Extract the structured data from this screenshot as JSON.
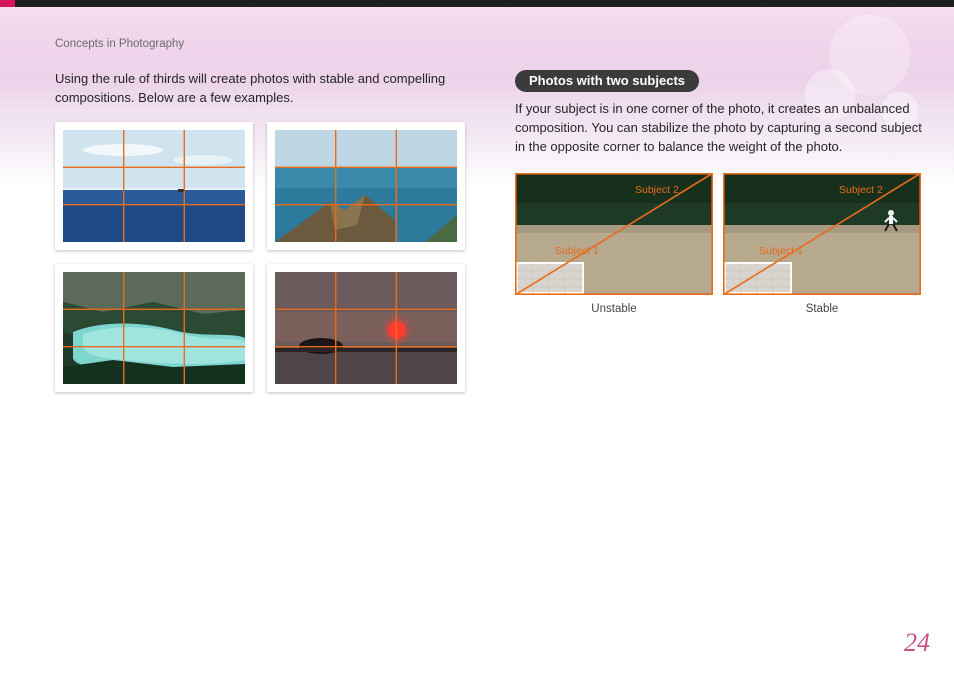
{
  "header": {
    "breadcrumb": "Concepts in Photography"
  },
  "left": {
    "intro": "Using the rule of thirds will create photos with stable and compelling compositions. Below are a few examples."
  },
  "right": {
    "section_title": "Photos with two subjects",
    "body": "If your subject is in one corner of the photo, it creates an unbalanced composition. You can stabilize the photo by capturing a second subject in the opposite corner to balance the weight of the photo.",
    "labels": {
      "subject1": "Subject 1",
      "subject2": "Subject 2"
    },
    "captions": {
      "unstable": "Unstable",
      "stable": "Stable"
    }
  },
  "page_number": "24"
}
